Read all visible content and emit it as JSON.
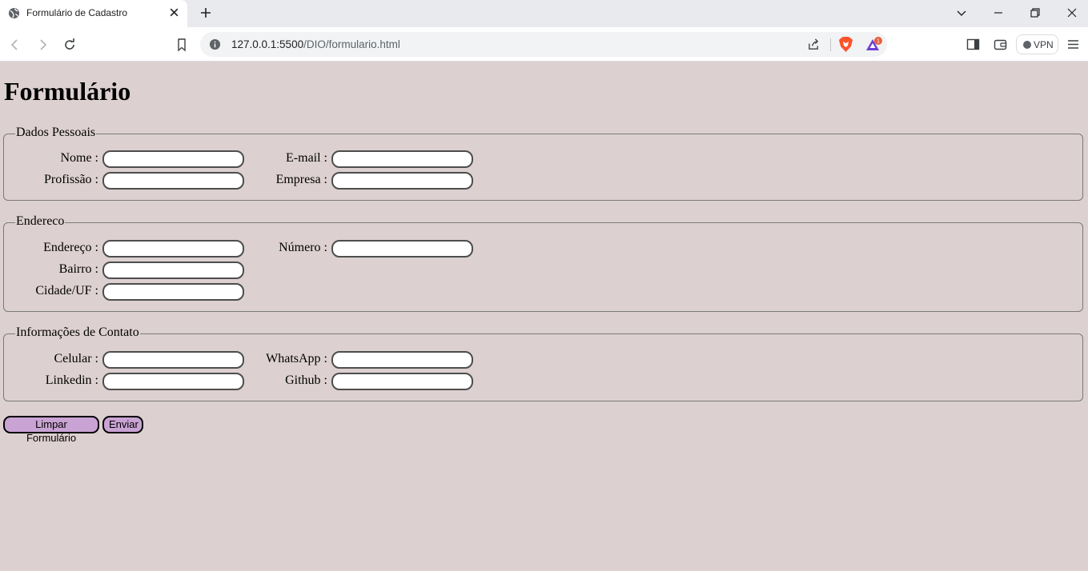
{
  "browser": {
    "tab_title": "Formulário de Cadastro",
    "url_host": "127.0.0.1:5500",
    "url_path": "/DIO/formulario.html",
    "vpn_label": "VPN",
    "rewards_badge": "1"
  },
  "page": {
    "title": "Formulário",
    "fieldsets": {
      "pessoais": {
        "legend": "Dados Pessoais",
        "nome": "Nome :",
        "email": "E-mail :",
        "profissao": "Profissão :",
        "empresa": "Empresa :"
      },
      "endereco": {
        "legend": "Endereco",
        "endereco": "Endereço :",
        "numero": "Número :",
        "bairro": "Bairro :",
        "cidade": "Cidade/UF :"
      },
      "contato": {
        "legend": "Informações de Contato",
        "celular": "Celular :",
        "whatsapp": "WhatsApp :",
        "linkedin": "Linkedin :",
        "github": "Github :"
      }
    },
    "buttons": {
      "reset": "Limpar Formulário",
      "submit": "Enviar"
    }
  },
  "colors": {
    "page_background": "#ddd0d0",
    "button_background": "#c9a3d4"
  }
}
